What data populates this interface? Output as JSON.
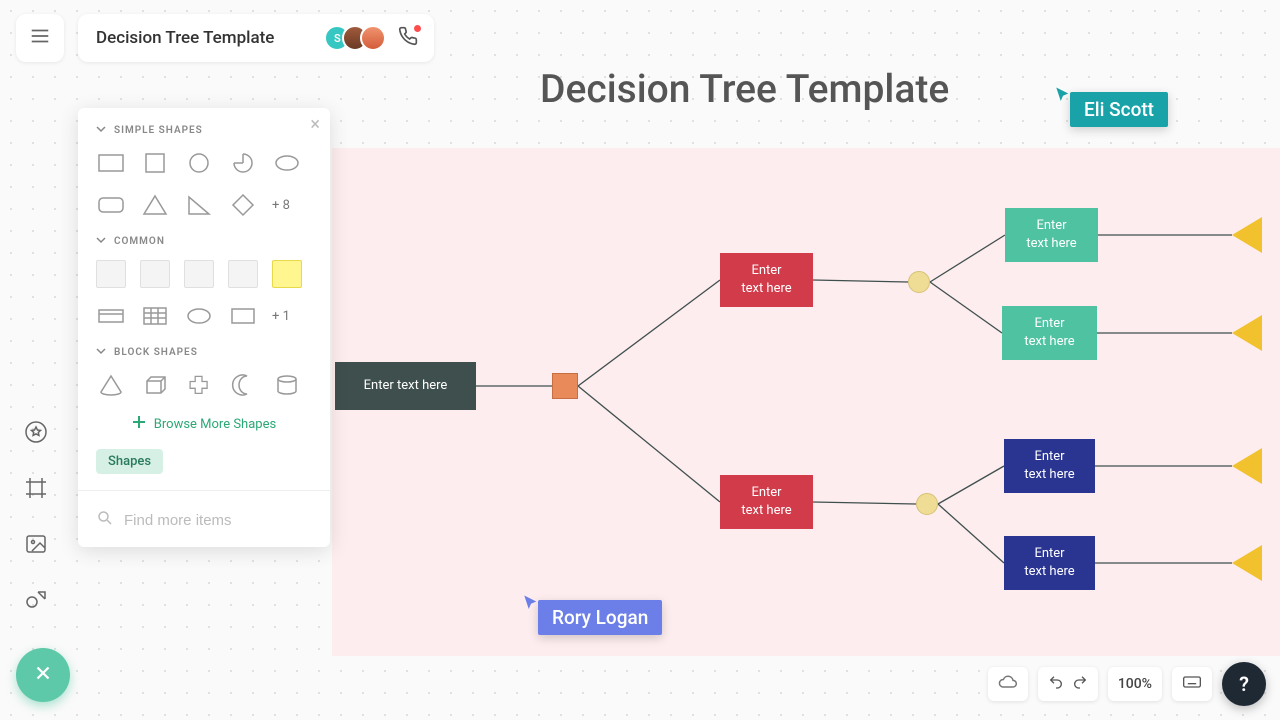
{
  "document": {
    "title": "Decision Tree Template"
  },
  "canvas": {
    "heading": "Decision Tree Template"
  },
  "presence": {
    "avatars": [
      {
        "initial": "S",
        "bg": "#37c7c2"
      },
      {
        "initial": "",
        "bg": "#8d4a36"
      },
      {
        "initial": "",
        "bg": "#e46a4e"
      }
    ]
  },
  "collaborators": {
    "eli": {
      "name": "Eli Scott",
      "color": "#1aa2a9"
    },
    "rory": {
      "name": "Rory Logan",
      "color": "#6c7fe8"
    }
  },
  "panel": {
    "sections": {
      "simple": {
        "label": "SIMPLE SHAPES",
        "more": "+ 8"
      },
      "common": {
        "label": "COMMON",
        "more": "+ 1"
      },
      "block": {
        "label": "BLOCK SHAPES"
      }
    },
    "browse_label": "Browse More Shapes",
    "tab_label": "Shapes",
    "search_placeholder": "Find more items"
  },
  "nodes": {
    "root": "Enter text here",
    "red_top": "Enter\ntext here",
    "red_bottom": "Enter\ntext here",
    "teal1": "Enter\ntext here",
    "teal2": "Enter\ntext here",
    "navy1": "Enter\ntext here",
    "navy2": "Enter\ntext here"
  },
  "footer": {
    "zoom": "100%",
    "help": "?"
  }
}
